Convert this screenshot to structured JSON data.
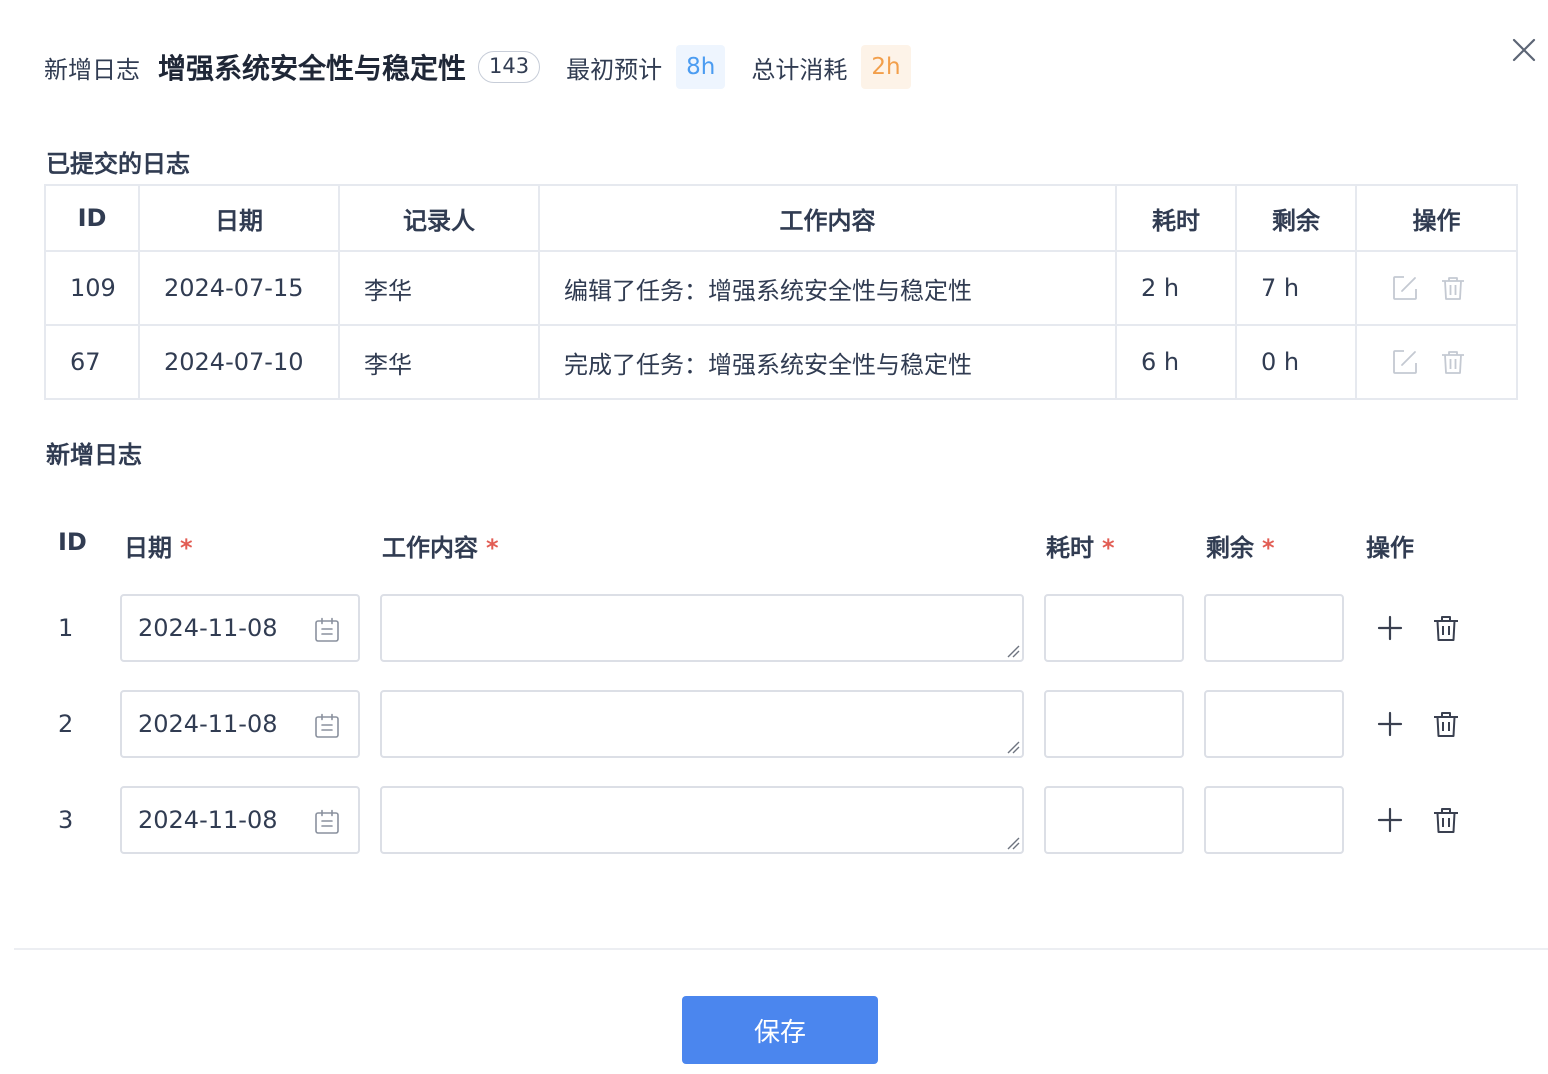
{
  "header": {
    "label": "新增日志",
    "task_title": "增强系统安全性与稳定性",
    "task_id": "143",
    "estimate_label": "最初预计",
    "estimate_value": "8h",
    "consumed_label": "总计消耗",
    "consumed_value": "2h"
  },
  "submitted": {
    "title": "已提交的日志",
    "columns": [
      "ID",
      "日期",
      "记录人",
      "工作内容",
      "耗时",
      "剩余",
      "操作"
    ],
    "rows": [
      {
        "id": "109",
        "date": "2024-07-15",
        "recorder": "李华",
        "content": "编辑了任务：增强系统安全性与稳定性",
        "spent": "2 h",
        "left": "7 h"
      },
      {
        "id": "67",
        "date": "2024-07-10",
        "recorder": "李华",
        "content": "完成了任务：增强系统安全性与稳定性",
        "spent": "6 h",
        "left": "0 h"
      }
    ]
  },
  "add_form": {
    "title": "新增日志",
    "col_id": "ID",
    "col_date": "日期",
    "col_content": "工作内容",
    "col_spent": "耗时",
    "col_left": "剩余",
    "col_ops": "操作",
    "required_mark": "*",
    "rows": [
      {
        "num": "1",
        "date": "2024-11-08",
        "content": "",
        "spent": "",
        "left": ""
      },
      {
        "num": "2",
        "date": "2024-11-08",
        "content": "",
        "spent": "",
        "left": ""
      },
      {
        "num": "3",
        "date": "2024-11-08",
        "content": "",
        "spent": "",
        "left": ""
      }
    ]
  },
  "footer": {
    "save_label": "保存"
  },
  "colors": {
    "primary": "#4b86ee",
    "estimate_pill": "#4b9cf1",
    "consumed_pill": "#f29f4b",
    "required": "#e25d54"
  },
  "icons": {
    "close": "close-icon",
    "edit": "edit-icon",
    "delete": "trash-icon",
    "calendar": "calendar-icon",
    "add": "plus-icon"
  }
}
